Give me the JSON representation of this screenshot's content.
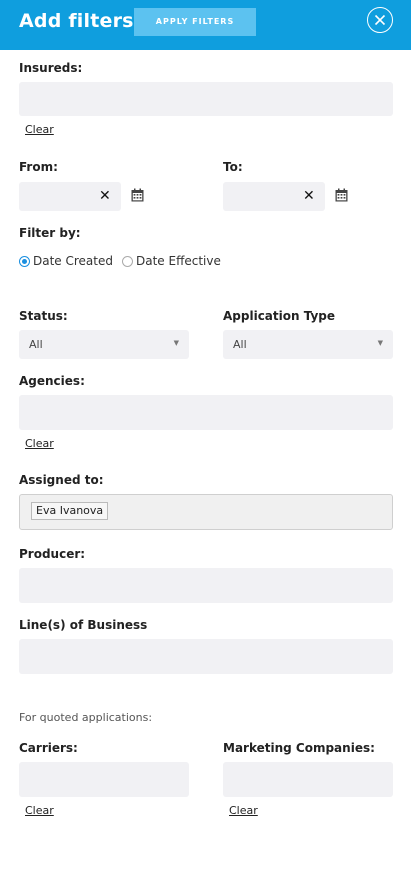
{
  "header": {
    "title": "Add filters",
    "apply_label": "APPLY FILTERS"
  },
  "insureds": {
    "label": "Insureds:",
    "clear": "Clear"
  },
  "dates": {
    "from_label": "From:",
    "to_label": "To:",
    "from_value": "",
    "to_value": ""
  },
  "filter_by": {
    "label": "Filter by:",
    "options": [
      "Date Created",
      "Date Effective"
    ],
    "selected": "Date Created"
  },
  "status": {
    "label": "Status:",
    "value": "All"
  },
  "application_type": {
    "label": "Application Type",
    "value": "All"
  },
  "agencies": {
    "label": "Agencies:",
    "clear": "Clear"
  },
  "assigned_to": {
    "label": "Assigned to:",
    "tags": [
      "Eva Ivanova"
    ]
  },
  "producer": {
    "label": "Producer:"
  },
  "lines_of_business": {
    "label": "Line(s) of Business"
  },
  "quoted": {
    "note": "For quoted applications:"
  },
  "carriers": {
    "label": "Carriers:",
    "clear": "Clear"
  },
  "marketing_companies": {
    "label": "Marketing Companies:",
    "clear": "Clear"
  },
  "colors": {
    "header": "#0f9ede",
    "apply_button": "#5cc2f0",
    "field": "#f1f1f4",
    "radio_selected": "#1a8fe0"
  },
  "icons": {
    "close": "close-circle-icon",
    "clear_date": "x-icon",
    "calendar": "calendar-icon",
    "dropdown": "caret-down-icon"
  }
}
